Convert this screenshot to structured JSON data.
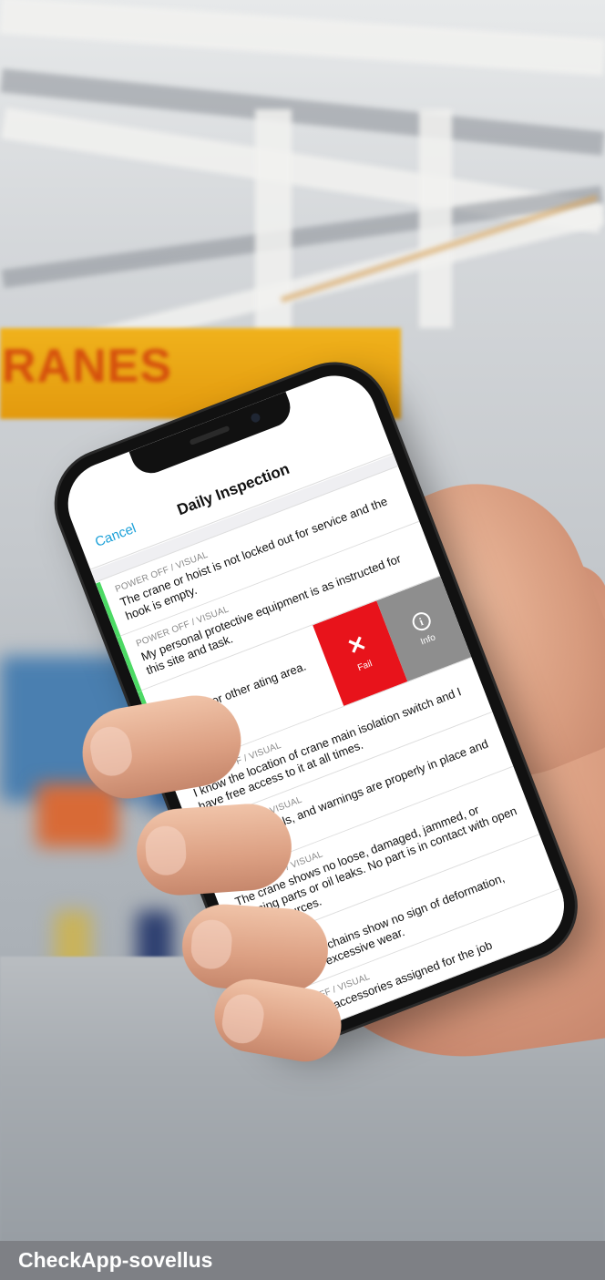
{
  "app": {
    "nav_title": "Daily Inspection",
    "cancel_label": "Cancel"
  },
  "swipe_actions": {
    "fail_label": "Fail",
    "info_label": "Info"
  },
  "items": [
    {
      "category": "POWER OFF / VISUAL",
      "text": "The crane or hoist is not locked out for service and the hook is empty.",
      "status": "passed"
    },
    {
      "category": "POWER OFF / VISUAL",
      "text": "My personal protective equipment is as instructed for this site and task.",
      "status": "passed"
    },
    {
      "category": "",
      "text": "oil spots, or other ating area.",
      "status": "swiped"
    },
    {
      "category": "POWER OFF / VISUAL",
      "text": "I know the location of crane main isolation switch and I have free access to it at all times."
    },
    {
      "category": "POWER OFF / VISUAL",
      "text": "All signs, labels, and warnings are properly in place and readable."
    },
    {
      "category": "POWER OFF / VISUAL",
      "text": "The crane shows no loose, damaged, jammed, or missing parts or oil leaks. No part is in contact with open power sources."
    },
    {
      "category": "VISUAL",
      "text": "The ropes or chains show no sign of deformation, damage, or excessive wear."
    },
    {
      "category": "POWER OFF / VISUAL",
      "text": "The lifting accessories assigned for the job"
    }
  ],
  "background": {
    "sign_text": "RANES"
  },
  "footer": {
    "title": "CheckApp-sovellus"
  },
  "colors": {
    "accent": "#1ba0d8",
    "fail": "#e8131b",
    "info": "#8e8e8e",
    "pass": "#4cd964",
    "footer_bg": "#7e8085"
  }
}
